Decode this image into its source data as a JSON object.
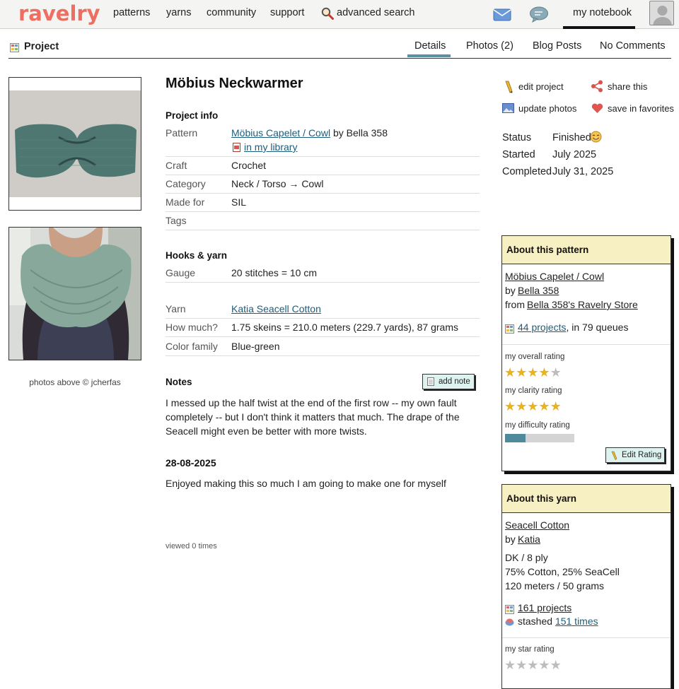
{
  "nav": {
    "logo": "ravelry",
    "patterns": "patterns",
    "yarns": "yarns",
    "community": "community",
    "support": "support",
    "advanced_search": "advanced search",
    "my_notebook": "my notebook"
  },
  "subnav": {
    "section": "Project",
    "tabs": [
      "Details",
      "Photos (2)",
      "Blog Posts",
      "No Comments"
    ],
    "active_tab": "Details"
  },
  "photos": {
    "credit": "photos above © jcherfas"
  },
  "project": {
    "title": "Möbius Neckwarmer",
    "info_heading": "Project info",
    "pattern_label": "Pattern",
    "pattern_link": "Möbius Capelet / Cowl",
    "pattern_by": "by Bella 358",
    "library_link": "in my library",
    "craft_label": "Craft",
    "craft": "Crochet",
    "category_label": "Category",
    "category": "Neck / Torso → Cowl",
    "made_for_label": "Made for",
    "made_for": "SIL",
    "tags_label": "Tags",
    "hooks_heading": "Hooks & yarn",
    "gauge_label": "Gauge",
    "gauge": "20 stitches = 10 cm",
    "yarn_label": "Yarn",
    "yarn_link": "Katia Seacell Cotton",
    "how_much_label": "How much?",
    "how_much": "1.75 skeins = 210.0 meters (229.7 yards), 87 grams",
    "color_family_label": "Color family",
    "color_family": "Blue-green",
    "notes_heading": "Notes",
    "add_note": "add note",
    "notes": "I messed up the half twist at the end of the first row -- my own fault completely -- but I don't think it matters that much. The drape of the Seacell might even be better with more twists.",
    "date_heading": "28-08-2025",
    "date_note": "Enjoyed making this so much I am going to make one for myself",
    "viewed": "viewed 0 times"
  },
  "actions": {
    "edit_project": "edit project",
    "share_this": "share this",
    "update_photos": "update photos",
    "save_favorites": "save in favorites"
  },
  "status": {
    "status_label": "Status",
    "status": "Finished",
    "started_label": "Started",
    "started": "July 2025",
    "completed_label": "Completed",
    "completed": "July 31, 2025"
  },
  "pattern_box": {
    "heading": "About this pattern",
    "name": "Möbius Capelet / Cowl",
    "by": "by",
    "designer": "Bella 358",
    "from": "from",
    "store": "Bella 358's Ravelry Store",
    "projects_link": "44 projects",
    "queues": ", in 79 queues",
    "overall_label": "my overall rating",
    "overall_rating": 4,
    "clarity_label": "my clarity rating",
    "clarity_rating": 5,
    "difficulty_label": "my difficulty rating",
    "difficulty_fraction": 0.3,
    "edit_rating": "Edit Rating"
  },
  "yarn_box": {
    "heading": "About this yarn",
    "name": "Seacell Cotton",
    "by": "by",
    "brand": "Katia",
    "weight": "DK / 8 ply",
    "fiber": "75% Cotton, 25% SeaCell",
    "yardage": "120 meters / 50 grams",
    "projects_link": "161 projects",
    "stashed_prefix": "stashed",
    "stashed_link": "151 times",
    "star_label": "my star rating",
    "star_rating": 0
  },
  "colors": {
    "brand": "#ee6e62",
    "link": "#1d5d7c",
    "box_header": "#f7f0c2",
    "button": "#def3ef",
    "star_on": "#e9b320",
    "difficulty_fill": "#4e8a9c"
  }
}
